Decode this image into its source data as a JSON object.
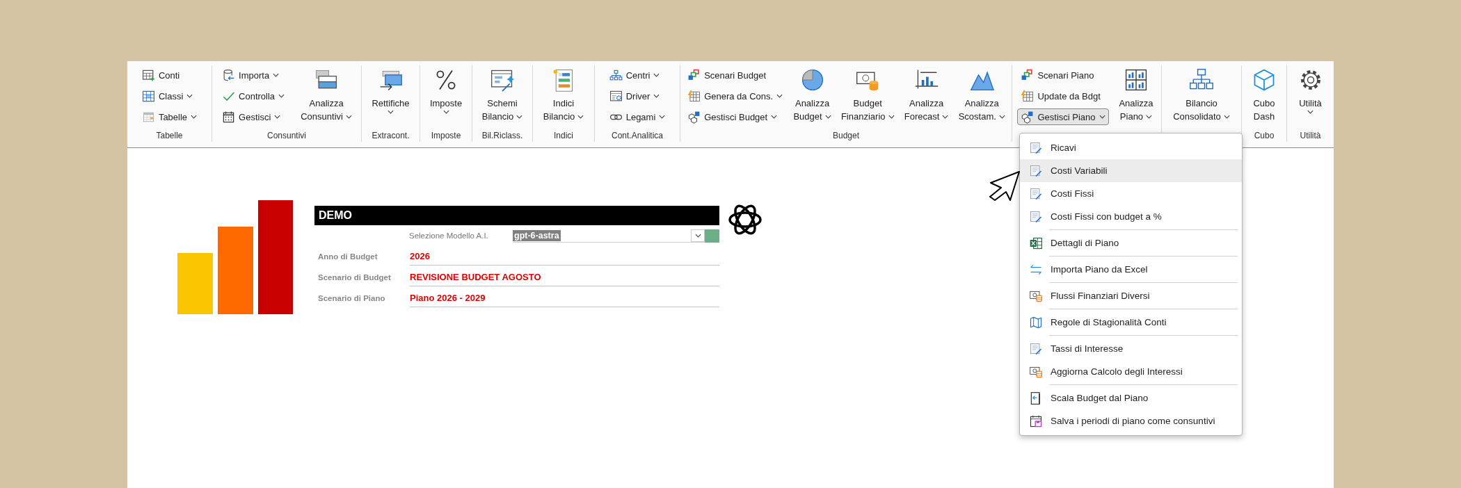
{
  "ribbon": {
    "groups": [
      {
        "label": "Tabelle",
        "columns": [
          {
            "kind": "stack",
            "items": [
              {
                "label": "Conti",
                "dropdown": false,
                "pressed": false
              },
              {
                "label": "Classi",
                "dropdown": true,
                "pressed": false
              },
              {
                "label": "Tabelle",
                "dropdown": true,
                "pressed": false
              }
            ]
          }
        ]
      },
      {
        "label": "Consuntivi",
        "columns": [
          {
            "kind": "stack",
            "items": [
              {
                "label": "Importa",
                "dropdown": true,
                "pressed": false
              },
              {
                "label": "Controlla",
                "dropdown": true,
                "pressed": false
              },
              {
                "label": "Gestisci",
                "dropdown": true,
                "pressed": false
              }
            ]
          },
          {
            "kind": "large",
            "lines": [
              "Analizza",
              "Consuntivi"
            ],
            "dropdown": true
          }
        ]
      },
      {
        "label": "Extracont.",
        "columns": [
          {
            "kind": "large",
            "lines": [
              "Rettifiche"
            ],
            "dropdown": true
          }
        ]
      },
      {
        "label": "Imposte",
        "columns": [
          {
            "kind": "large",
            "lines": [
              "Imposte"
            ],
            "dropdown": true
          }
        ]
      },
      {
        "label": "Bil.Riclass.",
        "columns": [
          {
            "kind": "large",
            "lines": [
              "Schemi",
              "Bilancio"
            ],
            "dropdown": true
          }
        ]
      },
      {
        "label": "Indici",
        "columns": [
          {
            "kind": "large",
            "lines": [
              "Indici",
              "Bilancio"
            ],
            "dropdown": true
          }
        ]
      },
      {
        "label": "Cont.Analitica",
        "columns": [
          {
            "kind": "stack",
            "items": [
              {
                "label": "Centri",
                "dropdown": true,
                "pressed": false
              },
              {
                "label": "Driver",
                "dropdown": true,
                "pressed": false
              },
              {
                "label": "Legami",
                "dropdown": true,
                "pressed": false
              }
            ]
          }
        ]
      },
      {
        "label": "Budget",
        "columns": [
          {
            "kind": "stack",
            "items": [
              {
                "label": "Scenari Budget",
                "dropdown": false,
                "pressed": false
              },
              {
                "label": "Genera da Cons.",
                "dropdown": true,
                "pressed": false
              },
              {
                "label": "Gestisci Budget",
                "dropdown": true,
                "pressed": false
              }
            ]
          },
          {
            "kind": "large",
            "lines": [
              "Analizza",
              "Budget"
            ],
            "dropdown": true
          },
          {
            "kind": "large",
            "lines": [
              "Budget",
              "Finanziario"
            ],
            "dropdown": true
          },
          {
            "kind": "large",
            "lines": [
              "Analizza",
              "Forecast"
            ],
            "dropdown": true
          },
          {
            "kind": "large",
            "lines": [
              "Analizza",
              "Scostam."
            ],
            "dropdown": true
          }
        ]
      },
      {
        "columns": [
          {
            "kind": "stack",
            "items": [
              {
                "label": "Scenari Piano",
                "dropdown": false,
                "pressed": false
              },
              {
                "label": "Update da Bdgt",
                "dropdown": false,
                "pressed": false
              },
              {
                "label": "Gestisci Piano",
                "dropdown": true,
                "pressed": true
              }
            ]
          },
          {
            "kind": "large",
            "lines": [
              "Analizza",
              "Piano"
            ],
            "dropdown": true
          }
        ]
      },
      {
        "columns": [
          {
            "kind": "large",
            "lines": [
              "Bilancio",
              "Consolidato"
            ],
            "dropdown": true
          }
        ]
      },
      {
        "label": "Cubo",
        "columns": [
          {
            "kind": "large",
            "lines": [
              "Cubo",
              "Dash"
            ],
            "dropdown": false
          }
        ]
      },
      {
        "label": "Utilità",
        "columns": [
          {
            "kind": "large",
            "lines": [
              "Utilità"
            ],
            "dropdown": true
          }
        ]
      }
    ]
  },
  "form": {
    "title": "DEMO",
    "model": {
      "label": "Selezione Modello A.I.",
      "value": "gpt-6-astra"
    },
    "fields": [
      {
        "label": "Anno di Budget",
        "value": "2026"
      },
      {
        "label": "Scenario di Budget",
        "value": "REVISIONE BUDGET AGOSTO"
      },
      {
        "label": "Scenario di Piano",
        "value": "Piano 2026 - 2029"
      }
    ]
  },
  "menu": {
    "sections": [
      {
        "items": [
          {
            "label": "Ricavi",
            "highlighted": false
          },
          {
            "label": "Costi Variabili",
            "highlighted": true
          },
          {
            "label": "Costi Fissi",
            "highlighted": false
          },
          {
            "label": "Costi Fissi con budget a %",
            "highlighted": false
          }
        ]
      },
      {
        "items": [
          {
            "label": "Dettagli di Piano",
            "highlighted": false
          }
        ]
      },
      {
        "items": [
          {
            "label": "Importa Piano da Excel",
            "highlighted": false
          }
        ]
      },
      {
        "items": [
          {
            "label": "Flussi Finanziari Diversi",
            "highlighted": false
          }
        ]
      },
      {
        "items": [
          {
            "label": "Regole di Stagionalità Conti",
            "highlighted": false
          }
        ]
      },
      {
        "items": [
          {
            "label": "Tassi di Interesse",
            "highlighted": false
          },
          {
            "label": "Aggiorna Calcolo degli Interessi",
            "highlighted": false
          }
        ]
      },
      {
        "items": [
          {
            "label": "Scala Budget dal Piano",
            "highlighted": false
          },
          {
            "label": "Salva i periodi di piano come consuntivi",
            "highlighted": false
          }
        ]
      }
    ]
  }
}
